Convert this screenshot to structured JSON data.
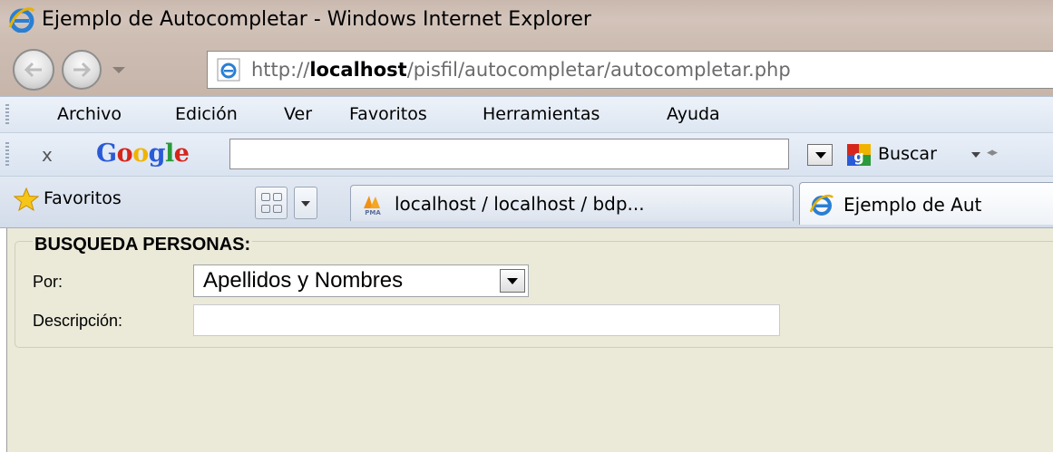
{
  "window": {
    "title": "Ejemplo de Autocompletar - Windows Internet Explorer"
  },
  "navigation": {
    "url_prefix": "http://",
    "url_host": "localhost",
    "url_path": "/pisfil/autocompletar/autocompletar.php"
  },
  "menu": {
    "items": [
      "Archivo",
      "Edición",
      "Ver",
      "Favoritos",
      "Herramientas",
      "Ayuda"
    ]
  },
  "google_toolbar": {
    "close_label": "x",
    "logo_text": "Google",
    "search_value": "",
    "search_button_label": "Buscar"
  },
  "favorites_bar": {
    "favorites_label": "Favoritos",
    "tabs": [
      {
        "label": "localhost / localhost / bdp...",
        "icon": "phpmyadmin-icon"
      },
      {
        "label": "Ejemplo de Aut",
        "icon": "ie-icon"
      }
    ]
  },
  "form": {
    "legend": "BUSQUEDA PERSONAS:",
    "por_label": "Por:",
    "por_selected": "Apellidos y Nombres",
    "descripcion_label": "Descripción:",
    "descripcion_value": ""
  },
  "colors": {
    "titlebar": "#cdbdb2",
    "content_bg": "#ebe9d8",
    "toolbar_bg": "#dde6f2"
  }
}
